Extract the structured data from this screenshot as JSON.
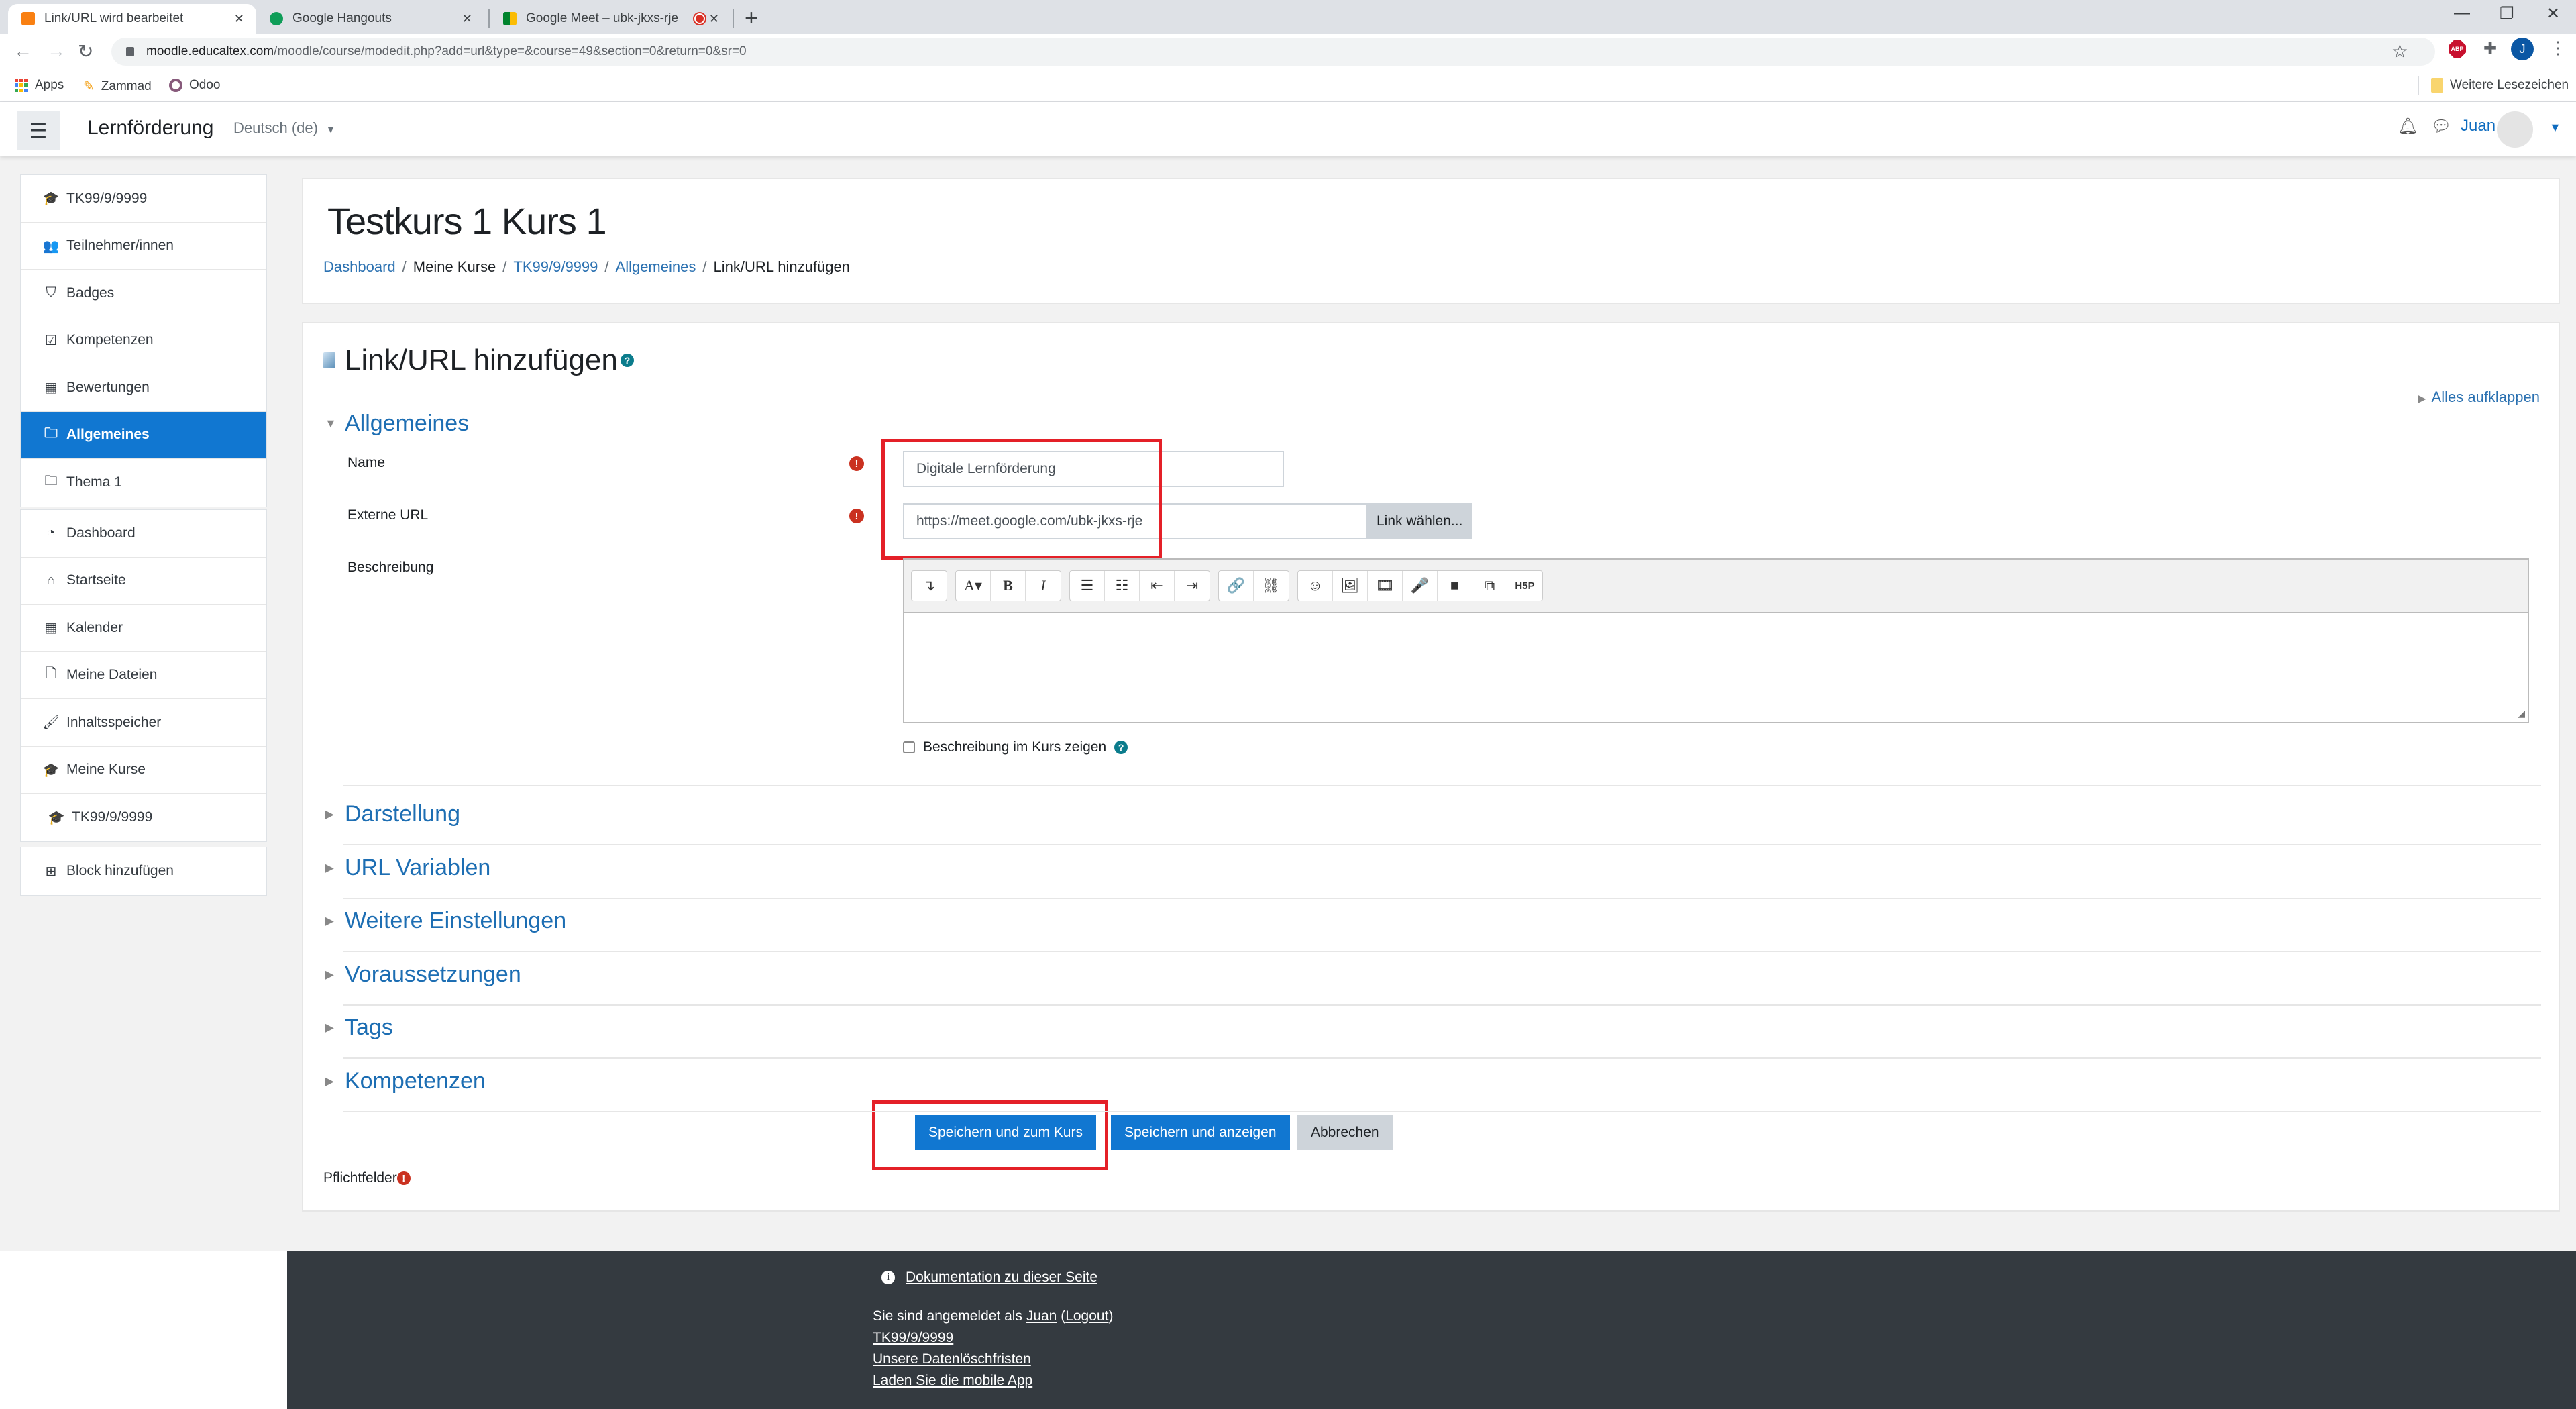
{
  "browser": {
    "tabs": [
      {
        "title": "Link/URL wird bearbeitet",
        "active": true,
        "favicon": "moodle-icon"
      },
      {
        "title": "Google Hangouts",
        "active": false,
        "favicon": "hangouts-icon"
      },
      {
        "title": "Google Meet – ubk-jkxs-rje",
        "active": false,
        "favicon": "meet-icon",
        "recording": true
      }
    ],
    "url_host": "moodle.educaltex.com",
    "url_path": "/moodle/course/modedit.php?add=url&type=&course=49&section=0&return=0&sr=0",
    "profile_initial": "J",
    "abp_label": "ABP",
    "bookmarks": [
      {
        "label": "Apps",
        "icon": "apps-grid-icon"
      },
      {
        "label": "Zammad",
        "icon": "zammad-icon"
      },
      {
        "label": "Odoo",
        "icon": "odoo-icon"
      }
    ],
    "other_bookmarks": "Weitere Lesezeichen"
  },
  "navbar": {
    "site_name": "Lernförderung",
    "language": "Deutsch (de)",
    "user_name": "Juan"
  },
  "sidebar": {
    "course_block": [
      {
        "label": "TK99/9/9999",
        "icon": "graduation-cap-icon",
        "glyph": "🎓"
      },
      {
        "label": "Teilnehmer/innen",
        "icon": "users-icon",
        "glyph": "👥"
      },
      {
        "label": "Badges",
        "icon": "shield-icon",
        "glyph": "⛉"
      },
      {
        "label": "Kompetenzen",
        "icon": "check-square-icon",
        "glyph": "☑"
      },
      {
        "label": "Bewertungen",
        "icon": "table-icon",
        "glyph": "▦"
      },
      {
        "label": "Allgemeines",
        "icon": "folder-icon",
        "glyph": "🗀",
        "active": true
      },
      {
        "label": "Thema 1",
        "icon": "folder-icon",
        "glyph": "🗀"
      }
    ],
    "site_block": [
      {
        "label": "Dashboard",
        "icon": "dashboard-icon",
        "glyph": "◔"
      },
      {
        "label": "Startseite",
        "icon": "home-icon",
        "glyph": "⌂"
      },
      {
        "label": "Kalender",
        "icon": "calendar-icon",
        "glyph": "▦"
      },
      {
        "label": "Meine Dateien",
        "icon": "file-icon",
        "glyph": "🗋"
      },
      {
        "label": "Inhaltsspeicher",
        "icon": "paintbrush-icon",
        "glyph": "🖌"
      },
      {
        "label": "Meine Kurse",
        "icon": "graduation-cap-icon",
        "glyph": "🎓"
      },
      {
        "label": "TK99/9/9999",
        "icon": "graduation-cap-icon",
        "glyph": "🎓",
        "sub": true
      }
    ],
    "add_block": {
      "label": "Block hinzufügen",
      "icon": "plus-square-icon",
      "glyph": "⊞"
    }
  },
  "header": {
    "course_title": "Testkurs 1 Kurs 1",
    "breadcrumb": [
      {
        "label": "Dashboard",
        "link": true
      },
      {
        "label": "Meine Kurse",
        "link": false
      },
      {
        "label": "TK99/9/9999",
        "link": true
      },
      {
        "label": "Allgemeines",
        "link": true
      },
      {
        "label": "Link/URL hinzufügen",
        "link": false
      }
    ],
    "separator": "/"
  },
  "form": {
    "title": "Link/URL hinzufügen",
    "expand_all": "Alles aufklappen",
    "general_section": "Allgemeines",
    "fields": {
      "name": {
        "label": "Name",
        "value": "Digitale Lernförderung",
        "required": true
      },
      "external_url": {
        "label": "Externe URL",
        "value": "https://meet.google.com/ubk-jkxs-rje",
        "required": true,
        "choose_button": "Link wählen..."
      },
      "description": {
        "label": "Beschreibung",
        "value": ""
      }
    },
    "editor_toolbar": [
      [
        {
          "name": "collapse-icon",
          "glyph": "↴"
        }
      ],
      [
        {
          "name": "font-color-icon",
          "glyph": "A▾"
        },
        {
          "name": "bold-icon",
          "glyph": "B"
        },
        {
          "name": "italic-icon",
          "glyph": "I"
        }
      ],
      [
        {
          "name": "unordered-list-icon",
          "glyph": "☰"
        },
        {
          "name": "ordered-list-icon",
          "glyph": "☷"
        },
        {
          "name": "outdent-icon",
          "glyph": "⇤"
        },
        {
          "name": "indent-icon",
          "glyph": "⇥"
        }
      ],
      [
        {
          "name": "link-icon",
          "glyph": "🔗"
        },
        {
          "name": "unlink-icon",
          "glyph": "⛓"
        }
      ],
      [
        {
          "name": "emoji-icon",
          "glyph": "☺"
        },
        {
          "name": "image-icon",
          "glyph": "🖼"
        },
        {
          "name": "media-icon",
          "glyph": "🎞"
        },
        {
          "name": "microphone-icon",
          "glyph": "🎤"
        },
        {
          "name": "video-icon",
          "glyph": "■"
        },
        {
          "name": "copy-icon",
          "glyph": "⧉"
        },
        {
          "name": "h5p-icon",
          "glyph": "H5P"
        }
      ]
    ],
    "show_description": {
      "label": "Beschreibung im Kurs zeigen",
      "checked": false
    },
    "collapsed_sections": [
      "Darstellung",
      "URL Variablen",
      "Weitere Einstellungen",
      "Voraussetzungen",
      "Tags",
      "Kompetenzen"
    ],
    "buttons": {
      "save_return": "Speichern und zum Kurs",
      "save_display": "Speichern und anzeigen",
      "cancel": "Abbrechen"
    },
    "required_note": "Pflichtfelder"
  },
  "footer": {
    "doc_link": "Dokumentation zu dieser Seite",
    "logged_in_prefix": "Sie sind angemeldet als",
    "user": "Juan",
    "logout": "Logout",
    "course_link": "TK99/9/9999",
    "data_retention": "Unsere Datenlöschfristen",
    "mobile_app": "Laden Sie die mobile App"
  },
  "colors": {
    "primary": "#1177d1",
    "link": "#2b71b1",
    "required": "#ca3120",
    "annotation": "#e42028",
    "footer_bg": "#343a40"
  }
}
